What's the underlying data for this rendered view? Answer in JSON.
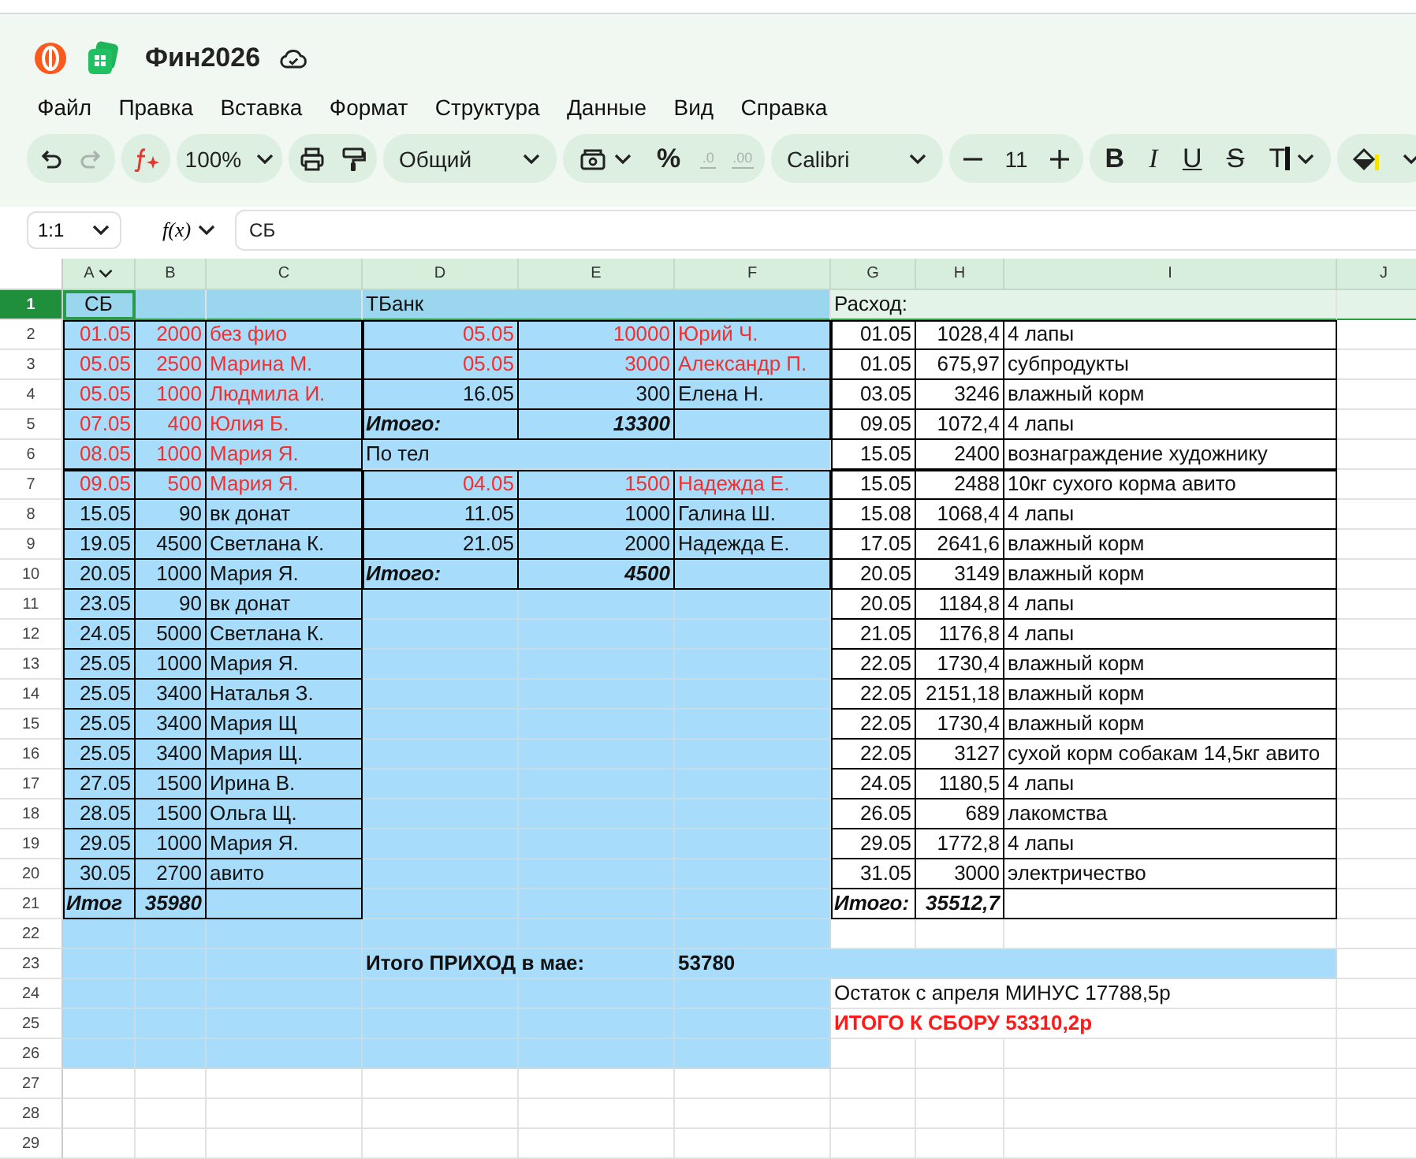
{
  "app": {
    "title": "Фин2026"
  },
  "menu": [
    "Файл",
    "Правка",
    "Вставка",
    "Формат",
    "Структура",
    "Данные",
    "Вид",
    "Справка"
  ],
  "toolbar": {
    "undo": {
      "disabled": false
    },
    "redo": {
      "disabled": true
    },
    "zoom": "100%",
    "number_format": "Общий",
    "percent": "%",
    "decimals": [
      {
        "label": ".0",
        "disabled": true
      },
      {
        "label": ".00",
        "disabled": true
      }
    ],
    "font": "Calibri",
    "font_size": "11",
    "bold": "B",
    "italic": "I",
    "underline": "U",
    "strike": "S",
    "text_color": "T"
  },
  "formula_bar": {
    "name_box": "1:1",
    "function_label": "f(x)",
    "value": "СБ"
  },
  "sheet": {
    "columns": [
      {
        "label": "A"
      },
      {
        "label": "B"
      },
      {
        "label": "C"
      },
      {
        "label": "D"
      },
      {
        "label": "E"
      },
      {
        "label": "F"
      },
      {
        "label": "G"
      },
      {
        "label": "H"
      },
      {
        "label": "I"
      },
      {
        "label": "J"
      }
    ],
    "rows": [
      {
        "number": "1",
        "selected": true,
        "cells": [
          {
            "text": "СБ",
            "kind": "center"
          },
          "",
          "",
          {
            "text": "ТБанк",
            "kind": "text"
          },
          "",
          "",
          {
            "text": "Расход:",
            "kind": "text"
          }
        ]
      },
      {
        "number": "2",
        "selected": false,
        "cells": [
          {
            "text": "01.05",
            "kind": "number",
            "color": "#f0302f"
          },
          {
            "text": "2000",
            "kind": "number",
            "color": "#f0302f"
          },
          {
            "text": "без фио",
            "kind": "text",
            "color": "#f0302f"
          },
          {
            "text": "05.05",
            "kind": "number",
            "color": "#f0302f"
          },
          {
            "text": "10000",
            "kind": "number",
            "color": "#f0302f"
          },
          {
            "text": "Юрий Ч.",
            "kind": "text",
            "color": "#f0302f"
          },
          {
            "text": "01.05",
            "kind": "number"
          },
          {
            "text": "1028,4",
            "kind": "number"
          },
          {
            "text": "4 лапы",
            "kind": "text"
          }
        ]
      },
      {
        "number": "3",
        "selected": false,
        "cells": [
          {
            "text": "05.05",
            "kind": "number",
            "color": "#f0302f"
          },
          {
            "text": "2500",
            "kind": "number",
            "color": "#f0302f"
          },
          {
            "text": "Марина М.",
            "kind": "text",
            "color": "#f0302f"
          },
          {
            "text": "05.05",
            "kind": "number",
            "color": "#f0302f"
          },
          {
            "text": "3000",
            "kind": "number",
            "color": "#f0302f"
          },
          {
            "text": "Александр П.",
            "kind": "text",
            "color": "#f0302f"
          },
          {
            "text": "01.05",
            "kind": "number"
          },
          {
            "text": "675,97",
            "kind": "number"
          },
          {
            "text": "субпродукты",
            "kind": "text"
          }
        ]
      },
      {
        "number": "4",
        "selected": false,
        "cells": [
          {
            "text": "05.05",
            "kind": "number",
            "color": "#f0302f"
          },
          {
            "text": "1000",
            "kind": "number",
            "color": "#f0302f"
          },
          {
            "text": "Людмила И.",
            "kind": "text",
            "color": "#f0302f"
          },
          {
            "text": "16.05",
            "kind": "number"
          },
          {
            "text": "300",
            "kind": "number"
          },
          {
            "text": "Елена Н.",
            "kind": "text"
          },
          {
            "text": "03.05",
            "kind": "number"
          },
          {
            "text": "3246",
            "kind": "number"
          },
          {
            "text": "влажный корм",
            "kind": "text"
          }
        ]
      },
      {
        "number": "5",
        "selected": false,
        "cells": [
          {
            "text": "07.05",
            "kind": "number",
            "color": "#f0302f"
          },
          {
            "text": "400",
            "kind": "number",
            "color": "#f0302f"
          },
          {
            "text": "Юлия Б.",
            "kind": "text",
            "color": "#f0302f"
          },
          {
            "text": "Итого:",
            "kind": "total"
          },
          {
            "text": "13300",
            "kind": "total-number"
          },
          "",
          {
            "text": "09.05",
            "kind": "number"
          },
          {
            "text": "1072,4",
            "kind": "number"
          },
          {
            "text": "4 лапы",
            "kind": "text"
          }
        ]
      },
      {
        "number": "6",
        "selected": false,
        "cells": [
          {
            "text": "08.05",
            "kind": "number",
            "color": "#f0302f"
          },
          {
            "text": "1000",
            "kind": "number",
            "color": "#f0302f"
          },
          {
            "text": "Мария Я.",
            "kind": "text",
            "color": "#f0302f"
          },
          {
            "text": "По тел",
            "kind": "text"
          },
          "",
          "",
          {
            "text": "15.05",
            "kind": "number"
          },
          {
            "text": "2400",
            "kind": "number"
          },
          {
            "text": "вознаграждение художнику",
            "kind": "text"
          }
        ]
      },
      {
        "number": "7",
        "selected": false,
        "cells": [
          {
            "text": "09.05",
            "kind": "number",
            "color": "#f0302f"
          },
          {
            "text": "500",
            "kind": "number",
            "color": "#f0302f"
          },
          {
            "text": "Мария Я.",
            "kind": "text",
            "color": "#f0302f"
          },
          {
            "text": "04.05",
            "kind": "number",
            "color": "#f0302f"
          },
          {
            "text": "1500",
            "kind": "number",
            "color": "#f0302f"
          },
          {
            "text": "Надежда Е.",
            "kind": "text",
            "color": "#f0302f"
          },
          {
            "text": "15.05",
            "kind": "number"
          },
          {
            "text": "2488",
            "kind": "number"
          },
          {
            "text": "10кг сухого корма авито",
            "kind": "text"
          }
        ]
      },
      {
        "number": "8",
        "selected": false,
        "cells": [
          {
            "text": "15.05",
            "kind": "number"
          },
          {
            "text": "90",
            "kind": "number"
          },
          {
            "text": "вк донат",
            "kind": "text"
          },
          {
            "text": "11.05",
            "kind": "number"
          },
          {
            "text": "1000",
            "kind": "number"
          },
          {
            "text": "Галина Ш.",
            "kind": "text"
          },
          {
            "text": "15.08",
            "kind": "number"
          },
          {
            "text": "1068,4",
            "kind": "number"
          },
          {
            "text": "4 лапы",
            "kind": "text"
          }
        ]
      },
      {
        "number": "9",
        "selected": false,
        "cells": [
          {
            "text": "19.05",
            "kind": "number"
          },
          {
            "text": "4500",
            "kind": "number"
          },
          {
            "text": "Светлана К.",
            "kind": "text"
          },
          {
            "text": "21.05",
            "kind": "number"
          },
          {
            "text": "2000",
            "kind": "number"
          },
          {
            "text": "Надежда Е.",
            "kind": "text"
          },
          {
            "text": "17.05",
            "kind": "number"
          },
          {
            "text": "2641,6",
            "kind": "number"
          },
          {
            "text": "влажный корм",
            "kind": "text"
          }
        ]
      },
      {
        "number": "10",
        "selected": false,
        "cells": [
          {
            "text": "20.05",
            "kind": "number"
          },
          {
            "text": "1000",
            "kind": "number"
          },
          {
            "text": "Мария Я.",
            "kind": "text"
          },
          {
            "text": "Итого:",
            "kind": "total"
          },
          {
            "text": "4500",
            "kind": "total-number"
          },
          "",
          {
            "text": "20.05",
            "kind": "number"
          },
          {
            "text": "3149",
            "kind": "number"
          },
          {
            "text": "влажный корм",
            "kind": "text"
          }
        ]
      },
      {
        "number": "11",
        "selected": false,
        "cells": [
          {
            "text": "23.05",
            "kind": "number"
          },
          {
            "text": "90",
            "kind": "number"
          },
          {
            "text": "вк донат",
            "kind": "text"
          },
          "",
          "",
          "",
          {
            "text": "20.05",
            "kind": "number"
          },
          {
            "text": "1184,8",
            "kind": "number"
          },
          {
            "text": "4 лапы",
            "kind": "text"
          }
        ]
      },
      {
        "number": "12",
        "selected": false,
        "cells": [
          {
            "text": "24.05",
            "kind": "number"
          },
          {
            "text": "5000",
            "kind": "number"
          },
          {
            "text": "Светлана К.",
            "kind": "text"
          },
          "",
          "",
          "",
          {
            "text": "21.05",
            "kind": "number"
          },
          {
            "text": "1176,8",
            "kind": "number"
          },
          {
            "text": "4 лапы",
            "kind": "text"
          }
        ]
      },
      {
        "number": "13",
        "selected": false,
        "cells": [
          {
            "text": "25.05",
            "kind": "number"
          },
          {
            "text": "1000",
            "kind": "number"
          },
          {
            "text": "Мария Я.",
            "kind": "text"
          },
          "",
          "",
          "",
          {
            "text": "22.05",
            "kind": "number"
          },
          {
            "text": "1730,4",
            "kind": "number"
          },
          {
            "text": "влажный корм",
            "kind": "text"
          }
        ]
      },
      {
        "number": "14",
        "selected": false,
        "cells": [
          {
            "text": "25.05",
            "kind": "number"
          },
          {
            "text": "3400",
            "kind": "number"
          },
          {
            "text": "Наталья З.",
            "kind": "text"
          },
          "",
          "",
          "",
          {
            "text": "22.05",
            "kind": "number"
          },
          {
            "text": "2151,18",
            "kind": "number"
          },
          {
            "text": "влажный корм",
            "kind": "text"
          }
        ]
      },
      {
        "number": "15",
        "selected": false,
        "cells": [
          {
            "text": "25.05",
            "kind": "number"
          },
          {
            "text": "3400",
            "kind": "number"
          },
          {
            "text": "Мария Щ",
            "kind": "text"
          },
          "",
          "",
          "",
          {
            "text": "22.05",
            "kind": "number"
          },
          {
            "text": "1730,4",
            "kind": "number"
          },
          {
            "text": "влажный корм",
            "kind": "text"
          }
        ]
      },
      {
        "number": "16",
        "selected": false,
        "cells": [
          {
            "text": "25.05",
            "kind": "number"
          },
          {
            "text": "3400",
            "kind": "number"
          },
          {
            "text": "Мария Щ.",
            "kind": "text"
          },
          "",
          "",
          "",
          {
            "text": "22.05",
            "kind": "number"
          },
          {
            "text": "3127",
            "kind": "number"
          },
          {
            "text": "сухой корм собакам 14,5кг авито",
            "kind": "text"
          }
        ]
      },
      {
        "number": "17",
        "selected": false,
        "cells": [
          {
            "text": "27.05",
            "kind": "number"
          },
          {
            "text": "1500",
            "kind": "number"
          },
          {
            "text": "Ирина В.",
            "kind": "text"
          },
          "",
          "",
          "",
          {
            "text": "24.05",
            "kind": "number"
          },
          {
            "text": "1180,5",
            "kind": "number"
          },
          {
            "text": "4 лапы",
            "kind": "text"
          }
        ]
      },
      {
        "number": "18",
        "selected": false,
        "cells": [
          {
            "text": "28.05",
            "kind": "number"
          },
          {
            "text": "1500",
            "kind": "number"
          },
          {
            "text": "Ольга Щ.",
            "kind": "text"
          },
          "",
          "",
          "",
          {
            "text": "26.05",
            "kind": "number"
          },
          {
            "text": "689",
            "kind": "number"
          },
          {
            "text": "лакомства",
            "kind": "text"
          }
        ]
      },
      {
        "number": "19",
        "selected": false,
        "cells": [
          {
            "text": "29.05",
            "kind": "number"
          },
          {
            "text": "1000",
            "kind": "number"
          },
          {
            "text": "Мария Я.",
            "kind": "text"
          },
          "",
          "",
          "",
          {
            "text": "29.05",
            "kind": "number"
          },
          {
            "text": "1772,8",
            "kind": "number"
          },
          {
            "text": "4 лапы",
            "kind": "text"
          }
        ]
      },
      {
        "number": "20",
        "selected": false,
        "cells": [
          {
            "text": "30.05",
            "kind": "number"
          },
          {
            "text": "2700",
            "kind": "number"
          },
          {
            "text": "авито",
            "kind": "text"
          },
          "",
          "",
          "",
          {
            "text": "31.05",
            "kind": "number"
          },
          {
            "text": "3000",
            "kind": "number"
          },
          {
            "text": "электричество",
            "kind": "text"
          }
        ]
      },
      {
        "number": "21",
        "selected": false,
        "cells": [
          {
            "text": "Итог",
            "kind": "total"
          },
          {
            "text": "35980",
            "kind": "total-number"
          },
          "",
          "",
          "",
          "",
          {
            "text": "Итого:",
            "kind": "total"
          },
          {
            "text": "35512,7",
            "kind": "total-number"
          }
        ]
      },
      {
        "number": "22",
        "selected": false,
        "cells": []
      },
      {
        "number": "23",
        "selected": false,
        "cells": [
          "",
          "",
          "",
          {
            "text": "Итого ПРИХОД в мае:",
            "kind": "bold"
          },
          "",
          {
            "text": "53780",
            "kind": "bold"
          }
        ]
      },
      {
        "number": "24",
        "selected": false,
        "cells": [
          "",
          "",
          "",
          "",
          "",
          "",
          {
            "text": "Остаток с апреля МИНУС 17788,5р",
            "kind": "text"
          }
        ]
      },
      {
        "number": "25",
        "selected": false,
        "cells": [
          "",
          "",
          "",
          "",
          "",
          "",
          {
            "text": "ИТОГО К СБОРУ 53310,2р",
            "kind": "bold",
            "color": "#ff1a1a"
          }
        ]
      },
      {
        "number": "26",
        "selected": false,
        "cells": []
      },
      {
        "number": "27",
        "selected": false,
        "cells": []
      },
      {
        "number": "28",
        "selected": false,
        "cells": []
      },
      {
        "number": "29",
        "selected": false,
        "cells": []
      }
    ]
  }
}
